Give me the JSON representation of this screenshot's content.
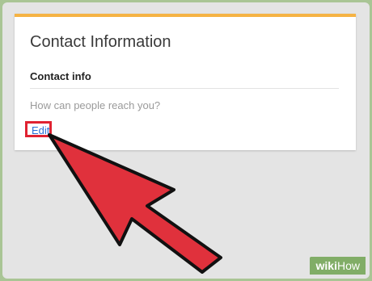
{
  "card": {
    "title": "Contact Information",
    "section_title": "Contact info",
    "prompt": "How can people reach you?",
    "edit_label": "Edit"
  },
  "watermark": {
    "part1": "wiki",
    "part2": "How"
  },
  "colors": {
    "accent_bar": "#f5b344",
    "highlight": "#e02231",
    "arrow_fill": "#e0313c",
    "link": "#2a6fd6",
    "frame_border": "#a9c595"
  },
  "icons": [
    "pointer-arrow-icon"
  ]
}
